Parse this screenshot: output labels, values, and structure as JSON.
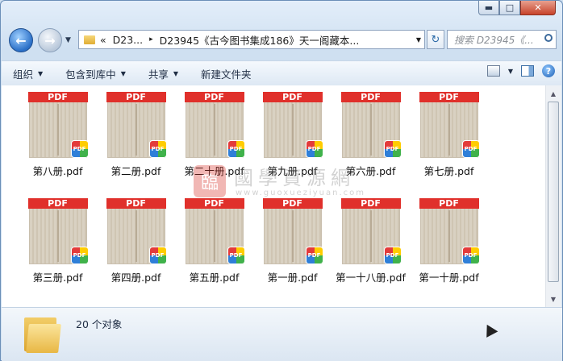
{
  "window": {
    "caption_buttons": {
      "minimize": "▬",
      "maximize": "□",
      "close": "✕"
    }
  },
  "nav": {
    "back_glyph": "←",
    "forward_glyph": "→",
    "address": {
      "prefix": "«",
      "segments": [
        "D23...",
        "D23945《古今图书集成186》天一阁藏本..."
      ],
      "separator": "▸"
    },
    "refresh_glyph": "↻",
    "search_placeholder": "搜索 D23945《..."
  },
  "toolbar": {
    "items": [
      "组织",
      "包含到库中",
      "共享",
      "新建文件夹"
    ]
  },
  "files": [
    "第八册.pdf",
    "第二册.pdf",
    "第二十册.pdf",
    "第九册.pdf",
    "第六册.pdf",
    "第七册.pdf",
    "第三册.pdf",
    "第四册.pdf",
    "第五册.pdf",
    "第一册.pdf",
    "第一十八册.pdf",
    "第一十册.pdf"
  ],
  "file_band_label": "PDF",
  "file_badge_label": "PDF",
  "watermark": {
    "seal": "臨",
    "cn": "國學資源網",
    "url": "www.guoxueziyuan.com"
  },
  "status": {
    "count": "20 个对象"
  },
  "colors": {
    "pdf_band": "#e0302b",
    "window_frame": "#cfe0f1",
    "accent": "#2a6fc7"
  }
}
